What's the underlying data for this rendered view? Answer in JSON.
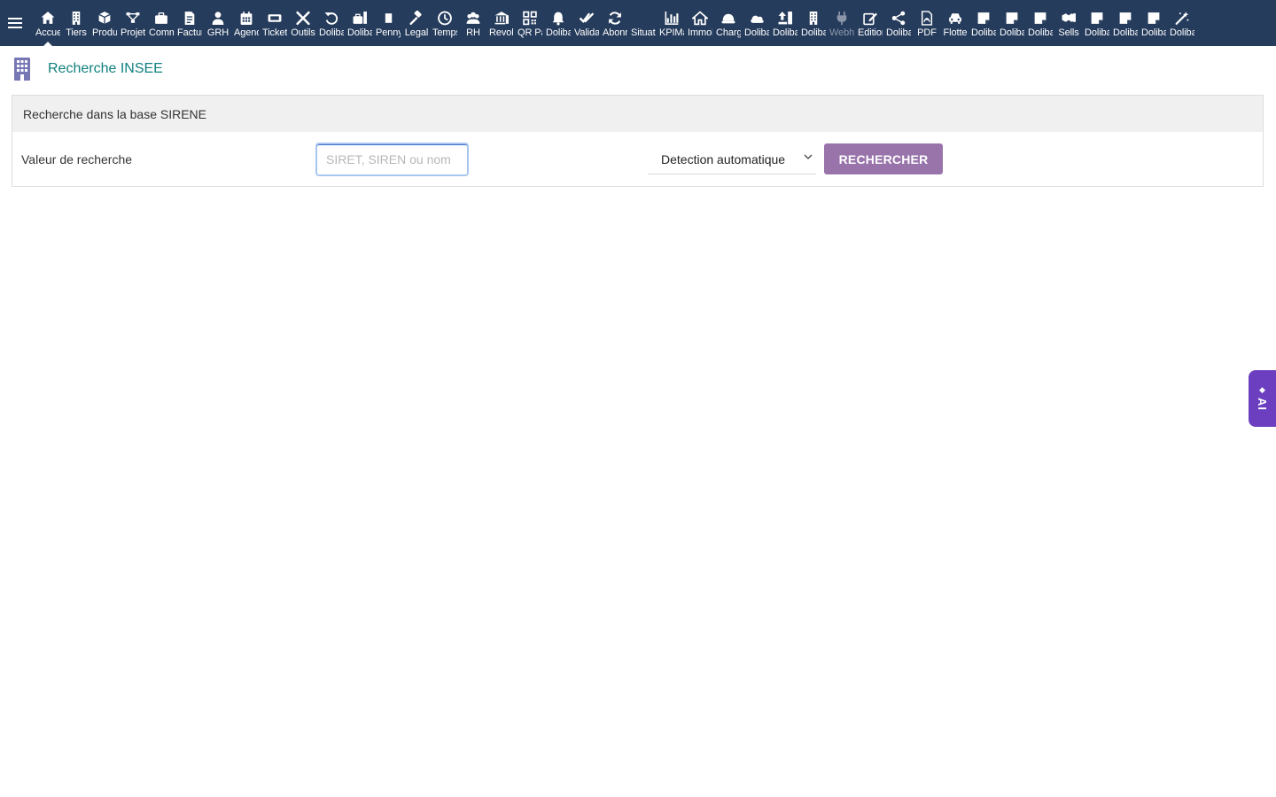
{
  "topbar": {
    "menu_icon": "hamburger-icon",
    "items": [
      {
        "label": "Accueil",
        "icon": "home-icon",
        "active": true
      },
      {
        "label": "Tiers",
        "icon": "building-icon"
      },
      {
        "label": "Produits",
        "icon": "cube-icon"
      },
      {
        "label": "Projets",
        "icon": "project-icon"
      },
      {
        "label": "Commerce",
        "icon": "briefcase-icon"
      },
      {
        "label": "Facturation",
        "icon": "invoice-icon"
      },
      {
        "label": "GRH",
        "icon": "user-tie-icon"
      },
      {
        "label": "Agenda",
        "icon": "calendar-icon"
      },
      {
        "label": "Tickets",
        "icon": "ticket-icon"
      },
      {
        "label": "Outils",
        "icon": "tools-icon"
      },
      {
        "label": "Dolibarr",
        "icon": "undo-icon"
      },
      {
        "label": "Dolibarr",
        "icon": "toolbox-icon"
      },
      {
        "label": "Penny",
        "icon": "note-icon"
      },
      {
        "label": "Legal",
        "icon": "gavel-icon"
      },
      {
        "label": "Temps",
        "icon": "clock-icon"
      },
      {
        "label": "RH",
        "icon": "users-icon"
      },
      {
        "label": "Revolut",
        "icon": "bank-icon"
      },
      {
        "label": "QR Pay",
        "icon": "qrcode-icon"
      },
      {
        "label": "Dolibarr",
        "icon": "bell-icon"
      },
      {
        "label": "Validation",
        "icon": "double-check-icon"
      },
      {
        "label": "Abonnements",
        "icon": "sync-icon"
      },
      {
        "label": "Situation",
        "icon": "blank-icon"
      },
      {
        "label": "KPIMaster",
        "icon": "chart-bar-icon"
      },
      {
        "label": "Immobilier",
        "icon": "house-icon"
      },
      {
        "label": "Chargement",
        "icon": "hard-hat-icon"
      },
      {
        "label": "Dolibarr",
        "icon": "cloud-icon"
      },
      {
        "label": "Dolibarr",
        "icon": "upload-icon"
      },
      {
        "label": "Dolibarr",
        "icon": "building-icon"
      },
      {
        "label": "Webhook",
        "icon": "plug-icon",
        "disabled": true
      },
      {
        "label": "Edition",
        "icon": "edit-icon"
      },
      {
        "label": "Dolibarr",
        "icon": "share-icon"
      },
      {
        "label": "PDF",
        "icon": "pdf-icon"
      },
      {
        "label": "Flotte",
        "icon": "car-icon"
      },
      {
        "label": "Dolibarr",
        "icon": "sticky-note-icon"
      },
      {
        "label": "Dolibarr",
        "icon": "sticky-note-icon"
      },
      {
        "label": "Dolibarr",
        "icon": "sticky-note-icon"
      },
      {
        "label": "Sells",
        "icon": "handshake-icon"
      },
      {
        "label": "Dolibarr",
        "icon": "sticky-note-icon"
      },
      {
        "label": "Dolibarr",
        "icon": "sticky-note-icon"
      },
      {
        "label": "Dolibarr",
        "icon": "sticky-note-icon"
      },
      {
        "label": "Dolibarr",
        "icon": "magic-wand-icon"
      }
    ]
  },
  "page": {
    "title": "Recherche INSEE",
    "title_icon": "building-icon"
  },
  "search": {
    "panel_title": "Recherche dans la base SIRENE",
    "field_label": "Valeur de recherche",
    "value": "",
    "placeholder": "SIRET, SIREN ou nom",
    "mode_selected": "Detection automatique",
    "submit_label": "RECHERCHER"
  },
  "ai_tab": {
    "label": "AI",
    "icon": "sparkle-icon"
  },
  "colors": {
    "topbar": "#263c5c",
    "accent_title": "#10817f",
    "button": "#9874ab",
    "ai_tab": "#6b3fc0"
  }
}
